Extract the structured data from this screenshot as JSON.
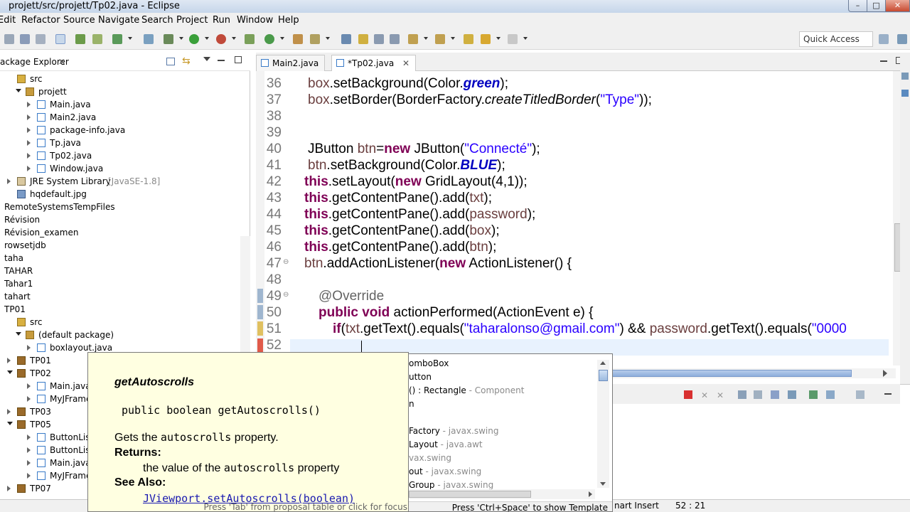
{
  "window": {
    "title": "projett/src/projett/Tp02.java - Eclipse"
  },
  "menu": [
    "Edit",
    "Refactor",
    "Source",
    "Navigate",
    "Search",
    "Project",
    "Run",
    "Window",
    "Help"
  ],
  "toolbar": {
    "quick_access": "Quick Access"
  },
  "package_explorer": {
    "title": "ackage Explorer",
    "items": [
      {
        "label": "src",
        "indent": 0,
        "icon": "src",
        "twisty": "none"
      },
      {
        "label": "projett",
        "indent": 1,
        "icon": "pkg",
        "twisty": "open"
      },
      {
        "label": "Main.java",
        "indent": 2,
        "icon": "java",
        "twisty": "closed"
      },
      {
        "label": "Main2.java",
        "indent": 2,
        "icon": "java",
        "twisty": "closed"
      },
      {
        "label": "package-info.java",
        "indent": 2,
        "icon": "java",
        "twisty": "closed"
      },
      {
        "label": "Tp.java",
        "indent": 2,
        "icon": "java",
        "twisty": "closed"
      },
      {
        "label": "Tp02.java",
        "indent": 2,
        "icon": "java",
        "twisty": "closed"
      },
      {
        "label": "Window.java",
        "indent": 2,
        "icon": "java",
        "twisty": "closed"
      },
      {
        "label": "JRE System Library",
        "suffix": "[JavaSE-1.8]",
        "indent": 0,
        "icon": "lib",
        "twisty": "closed"
      },
      {
        "label": "hqdefault.jpg",
        "indent": 0,
        "icon": "img",
        "twisty": "none"
      },
      {
        "label": "RemoteSystemsTempFiles",
        "indent": -1,
        "icon": "none",
        "twisty": "none"
      },
      {
        "label": "Révision",
        "indent": -1,
        "icon": "none",
        "twisty": "none"
      },
      {
        "label": "Révision_examen",
        "indent": -1,
        "icon": "none",
        "twisty": "none"
      },
      {
        "label": "rowsetjdb",
        "indent": -1,
        "icon": "none",
        "twisty": "none"
      },
      {
        "label": "taha",
        "indent": -1,
        "icon": "none",
        "twisty": "none"
      },
      {
        "label": "TAHAR",
        "indent": -1,
        "icon": "none",
        "twisty": "none"
      },
      {
        "label": "Tahar1",
        "indent": -1,
        "icon": "none",
        "twisty": "none"
      },
      {
        "label": "tahart",
        "indent": -1,
        "icon": "none",
        "twisty": "none"
      },
      {
        "label": "TP01",
        "indent": -1,
        "icon": "none",
        "twisty": "none"
      },
      {
        "label": "src",
        "indent": 0,
        "icon": "src",
        "twisty": "none"
      },
      {
        "label": "(default package)",
        "indent": 1,
        "icon": "pkg",
        "twisty": "open"
      },
      {
        "label": "boxlayout.java",
        "indent": 2,
        "icon": "java",
        "twisty": "closed"
      },
      {
        "label": "TP01",
        "indent": 0,
        "icon": "proj",
        "twisty": "closed"
      },
      {
        "label": "TP02",
        "indent": 0,
        "icon": "proj",
        "twisty": "open"
      },
      {
        "label": "Main.java",
        "indent": 2,
        "icon": "java",
        "twisty": "closed"
      },
      {
        "label": "MyJFrame.j",
        "indent": 2,
        "icon": "java",
        "twisty": "closed"
      },
      {
        "label": "TP03",
        "indent": 0,
        "icon": "proj",
        "twisty": "closed"
      },
      {
        "label": "TP05",
        "indent": 0,
        "icon": "proj",
        "twisty": "open"
      },
      {
        "label": "ButtonListe",
        "indent": 2,
        "icon": "java",
        "twisty": "closed"
      },
      {
        "label": "ButtonListe",
        "indent": 2,
        "icon": "java",
        "twisty": "closed"
      },
      {
        "label": "Main.java",
        "indent": 2,
        "icon": "java",
        "twisty": "closed"
      },
      {
        "label": "MyJFrame.j",
        "indent": 2,
        "icon": "java",
        "twisty": "closed"
      },
      {
        "label": "TP07",
        "indent": 0,
        "icon": "proj",
        "twisty": "closed"
      }
    ]
  },
  "editor": {
    "tabs": [
      {
        "label": "Main2.java",
        "active": false
      },
      {
        "label": "*Tp02.java",
        "active": true
      }
    ],
    "lines": [
      {
        "n": "36",
        "fold": "",
        "html": "<span class=\"var\">box</span>.setBackground(Color.<span class=\"fld\">green</span>);",
        "ind": 5
      },
      {
        "n": "37",
        "fold": "",
        "html": "<span class=\"var\">box</span>.setBorder(BorderFactory.<span class=\"it\">createTitledBorder</span>(<span class=\"str\">\"Type\"</span>));",
        "ind": 5
      },
      {
        "n": "38",
        "fold": "",
        "html": "",
        "ind": 5
      },
      {
        "n": "39",
        "fold": "",
        "html": "",
        "ind": 5
      },
      {
        "n": "40",
        "fold": "",
        "html": "JButton <span class=\"var\">btn</span>=<span class=\"kw\">new</span> JButton(<span class=\"str\">\"Connecté\"</span>);",
        "ind": 5
      },
      {
        "n": "41",
        "fold": "",
        "html": "<span class=\"var\">btn</span>.setBackground(Color.<span class=\"fld\">BLUE</span>);",
        "ind": 5
      },
      {
        "n": "42",
        "fold": "",
        "html": "<span class=\"kw\">this</span>.setLayout(<span class=\"kw\">new</span> GridLayout(4,1));",
        "ind": 0
      },
      {
        "n": "43",
        "fold": "",
        "html": "<span class=\"kw\">this</span>.getContentPane().add(<span class=\"var\">txt</span>);",
        "ind": 0
      },
      {
        "n": "44",
        "fold": "",
        "html": "<span class=\"kw\">this</span>.getContentPane().add(<span class=\"var\">password</span>);",
        "ind": 0
      },
      {
        "n": "45",
        "fold": "",
        "html": "<span class=\"kw\">this</span>.getContentPane().add(<span class=\"var\">box</span>);",
        "ind": 0
      },
      {
        "n": "46",
        "fold": "",
        "html": "<span class=\"kw\">this</span>.getContentPane().add(<span class=\"var\">btn</span>);",
        "ind": 0
      },
      {
        "n": "47",
        "fold": "⊖",
        "html": "<span class=\"var\">btn</span>.addActionListener(<span class=\"kw\">new</span> ActionListener() {",
        "ind": 0
      },
      {
        "n": "48",
        "fold": "",
        "html": "",
        "ind": 0
      },
      {
        "n": "49",
        "fold": "⊖",
        "html": "<span class=\"ann\">@Override</span>",
        "ind": 20
      },
      {
        "n": "50",
        "fold": "",
        "html": "<span class=\"kw\">public void</span> actionPerformed(ActionEvent e) {",
        "ind": 20
      },
      {
        "n": "51",
        "fold": "",
        "html": "<span class=\"kw\">if</span>(<span class=\"var\">txt</span>.getText().equals(<span class=\"str\">\"taharalonso@gmail.com\"</span>) &amp;&amp; <span class=\"var\">password</span>.getText().equals(<span class=\"str\">\"0000</span>",
        "ind": 40
      },
      {
        "n": "52",
        "fold": "",
        "html": "",
        "ind": 0
      }
    ]
  },
  "javadoc": {
    "heading": "getAutoscrolls",
    "signature": "public boolean getAutoscrolls()",
    "desc_pre": "Gets the ",
    "desc_code": "autoscrolls",
    "desc_post": " property.",
    "returns_label": "Returns:",
    "returns_pre": "the value of the ",
    "returns_code": "autoscrolls",
    "returns_post": " property",
    "see_also_label": "See Also:",
    "see_also_link": "JViewport.setAutoscrolls(boolean)",
    "footer": "Press 'Tab' from proposal table or click for focus"
  },
  "proposals": {
    "items": [
      {
        "text": "omboBox",
        "pkg": ""
      },
      {
        "text": "utton",
        "pkg": ""
      },
      {
        "text": "() : Rectangle",
        "pkg": " - Component"
      },
      {
        "text": "n",
        "pkg": ""
      },
      {
        "text": "",
        "pkg": ""
      },
      {
        "text": "Factory",
        "pkg": " - javax.swing"
      },
      {
        "text": "Layout",
        "pkg": " - java.awt"
      },
      {
        "text": "",
        "pkg": "vax.swing"
      },
      {
        "text": "out",
        "pkg": " - javax.swing"
      },
      {
        "text": "Group",
        "pkg": " - javax.swing"
      }
    ],
    "footer": "Press 'Ctrl+Space' to show Template Proposals"
  },
  "statusbar": {
    "mode": "nart Insert",
    "position": "52 : 21"
  },
  "colors": {
    "keyword": "#7f0055",
    "string": "#2a00ff",
    "field": "#0000c0",
    "javadoc_bg": "#ffffe1"
  }
}
